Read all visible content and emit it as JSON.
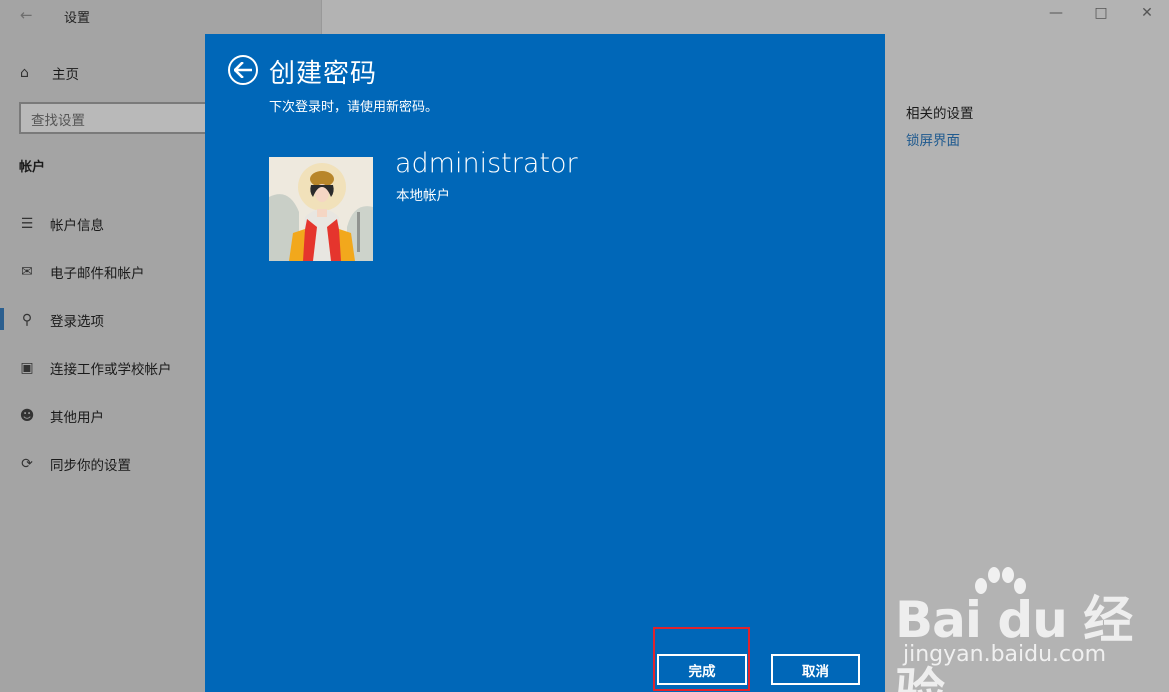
{
  "window": {
    "title": "设置",
    "back_icon": "back-arrow-icon",
    "controls": [
      "minimize-icon",
      "maximize-icon",
      "close-icon"
    ]
  },
  "sidebar": {
    "home_label": "主页",
    "search_placeholder": "查找设置",
    "section": "帐户",
    "items": [
      {
        "label": "帐户信息",
        "icon": "account-info-icon"
      },
      {
        "label": "电子邮件和帐户",
        "icon": "email-icon"
      },
      {
        "label": "登录选项",
        "icon": "key-icon",
        "selected": true
      },
      {
        "label": "连接工作或学校帐户",
        "icon": "briefcase-icon"
      },
      {
        "label": "其他用户",
        "icon": "person-add-icon"
      },
      {
        "label": "同步你的设置",
        "icon": "sync-icon"
      }
    ]
  },
  "related": {
    "title": "相关的设置",
    "link": "锁屏界面"
  },
  "dialog": {
    "title": "创建密码",
    "subtitle": "下次登录时，请使用新密码。",
    "username": "administrator",
    "account_type": "本地帐户",
    "done_label": "完成",
    "cancel_label": "取消",
    "background_color": "#0067b8"
  },
  "watermark": {
    "main": "Bai du 经验",
    "sub": "jingyan.baidu.com"
  }
}
